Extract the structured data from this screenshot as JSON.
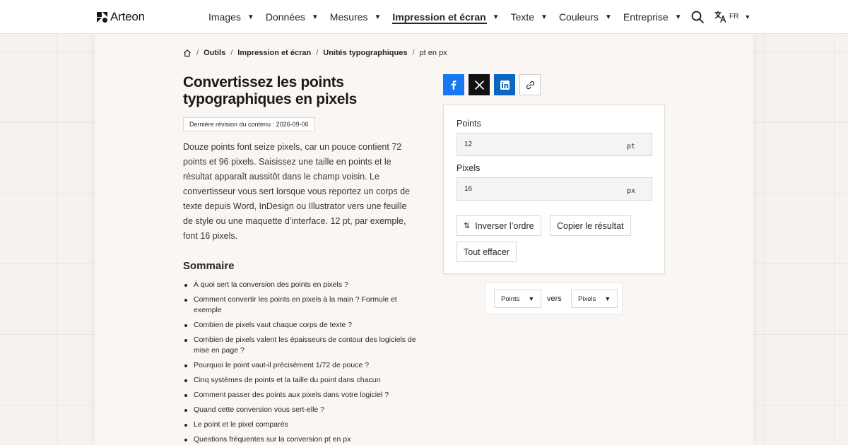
{
  "brand": {
    "name": "Arteon"
  },
  "nav": {
    "items": [
      {
        "label": "Images",
        "active": false
      },
      {
        "label": "Données",
        "active": false
      },
      {
        "label": "Mesures",
        "active": false
      },
      {
        "label": "Impression et écran",
        "active": true
      },
      {
        "label": "Texte",
        "active": false
      },
      {
        "label": "Couleurs",
        "active": false
      },
      {
        "label": "Entreprise",
        "active": false
      }
    ],
    "search_icon": "search-icon",
    "language": "FR"
  },
  "breadcrumb": {
    "items": [
      "Outils",
      "Impression et écran",
      "Unités typographiques"
    ],
    "current": "pt en px"
  },
  "page": {
    "title": "Convertissez les points typographiques en pixels",
    "revision": "Dernière révision du contenu : 2026-09-06",
    "intro": "Douze points font seize pixels, car un pouce contient 72 points et 96 pixels. Saisissez une taille en points et le résultat apparaît aussitôt dans le champ voisin. Le convertisseur vous sert lorsque vous reportez un corps de texte depuis Word, InDesign ou Illustrator vers une feuille de style ou une maquette d’interface. 12 pt, par exemple, font 16 pixels."
  },
  "toc": {
    "title": "Sommaire",
    "items": [
      "À quoi sert la conversion des points en pixels ?",
      "Comment convertir les points en pixels à la main ? Formule et exemple",
      "Combien de pixels vaut chaque corps de texte ?",
      "Combien de pixels valent les épaisseurs de contour des logiciels de mise en page ?",
      "Pourquoi le point vaut-il précisément 1/72 de pouce ?",
      "Cinq systèmes de points et la taille du point dans chacun",
      "Comment passer des points aux pixels dans votre logiciel ?",
      "Quand cette conversion vous sert-elle ?",
      "Le point et le pixel comparés",
      "Questions fréquentes sur la conversion pt en px"
    ]
  },
  "share": {
    "buttons": [
      "facebook-icon",
      "x-icon",
      "linkedin-icon",
      "link-icon"
    ],
    "colors": {
      "facebook": "#1877f2",
      "x": "#111111",
      "linkedin": "#0a66c2"
    }
  },
  "converter": {
    "points_label": "Points",
    "points_value": "12",
    "points_unit": "pt",
    "pixels_label": "Pixels",
    "pixels_value": "16",
    "pixels_unit": "px",
    "swap_label": "Inverser l’ordre",
    "copy_label": "Copier le résultat",
    "clear_label": "Tout effacer"
  },
  "units": {
    "from": "Points",
    "to": "Pixels",
    "connector": "vers"
  }
}
